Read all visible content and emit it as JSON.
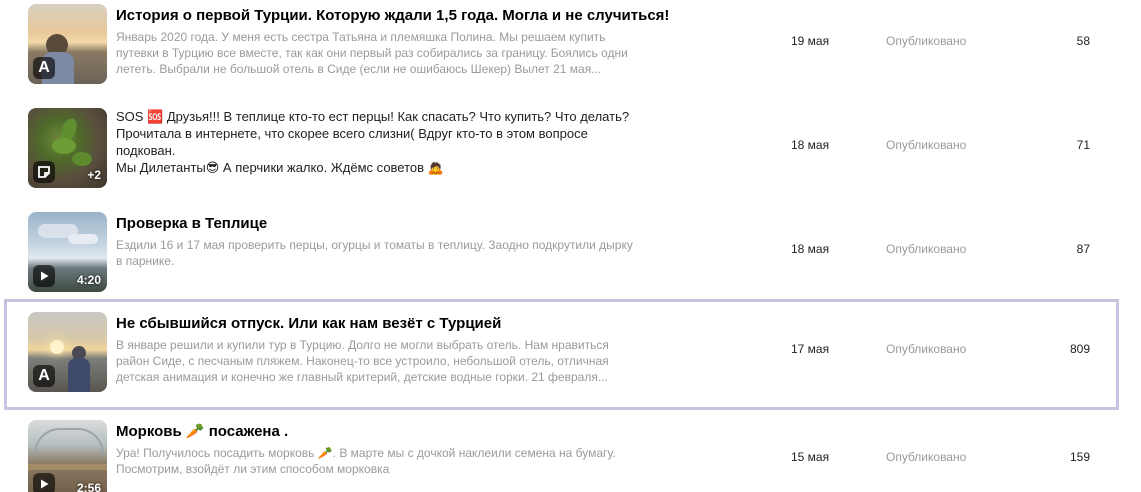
{
  "posts": [
    {
      "title": "История о первой Турции. Которую ждали 1,5 года. Могла и не случиться!",
      "snippet": "Январь 2020 года. У меня есть сестра Татьяна и племяшка Полина. Мы решаем купить путевки в Турцию все вместе, так как они первый раз собирались за границу. Боялись одни лететь. Выбрали не большой отель в Сиде (если не ошибаюсь Шекер) Вылет 21 мая...",
      "date": "19 мая",
      "status": "Опубликовано",
      "views": "58",
      "badge": "A",
      "badge_icon": "article-icon"
    },
    {
      "title_lines": [
        "SOS 🆘 Друзья!!! В теплице кто-то ест перцы! Как спасать? Что купить? Что делать?",
        "Прочитала в интернете, что скорее всего слизни( Вдруг кто-то в этом вопросе подкован.",
        "Мы Дилетанты😎 А перчики жалко. Ждёмс советов 🙇"
      ],
      "date": "18 мая",
      "status": "Опубликовано",
      "views": "71",
      "badge_icon": "note-icon",
      "extra_count": "+2"
    },
    {
      "title": "Проверка в Теплице",
      "snippet": "Ездили 16 и 17 мая проверить перцы, огурцы и томаты в теплицу. Заодно подкрутили дырку в парнике.",
      "date": "18 мая",
      "status": "Опубликовано",
      "views": "87",
      "badge_icon": "play-icon",
      "duration": "4:20"
    },
    {
      "title": "Не сбывшийся отпуск. Или как нам везёт с Турцией",
      "snippet": "В январе решили и купили тур в Турцию. Долго не могли выбрать отель. Нам нравиться район Сиде, с песчаным пляжем. Наконец-то все устроило, небольшой отель, отличная детская анимация и конечно же главный критерий, детские водные горки. 21 февраля...",
      "date": "17 мая",
      "status": "Опубликовано",
      "views": "809",
      "badge": "A",
      "badge_icon": "article-icon"
    },
    {
      "title": "Морковь 🥕 посажена .",
      "snippet": "Ура! Получилось посадить морковь 🥕. В марте мы с дочкой наклеили семена на бумагу. Посмотрим, взойдёт ли этим способом морковка",
      "date": "15 мая",
      "status": "Опубликовано",
      "views": "159",
      "badge_icon": "play-icon",
      "duration": "2:56"
    }
  ],
  "colors": {
    "selected_border": "#c9c3e0",
    "muted_text": "#9a9a9a"
  }
}
